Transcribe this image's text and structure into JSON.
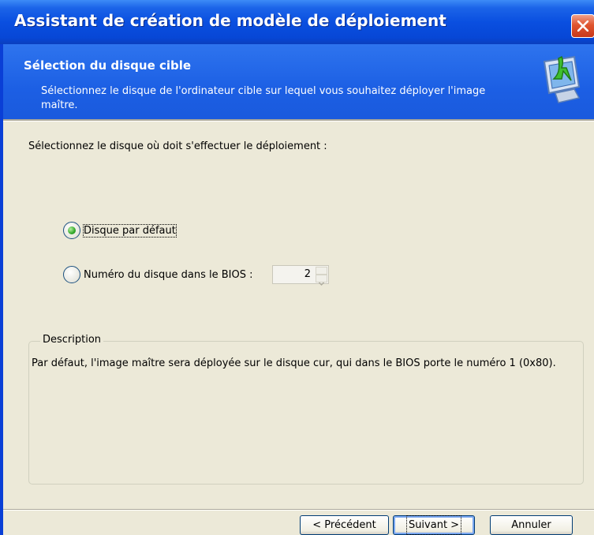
{
  "window": {
    "title": "Assistant de création de modèle de déploiement",
    "close_icon": "close-icon"
  },
  "header": {
    "title": "Sélection du disque cible",
    "description": "Sélectionnez le disque de l'ordinateur cible sur lequel vous souhaitez déployer l'image maître.",
    "icon": "monitor-install-icon"
  },
  "body": {
    "prompt": "Sélectionnez le disque où doit s'effectuer le déploiement :",
    "options": [
      {
        "label": "Disque par défaut",
        "selected": true
      },
      {
        "label": "Numéro du disque dans le BIOS :",
        "selected": false
      }
    ],
    "bios_disk_number": "2"
  },
  "description_group": {
    "title": "Description",
    "text": "Par défaut, l'image maître sera déployée sur le disque cur, qui dans le BIOS porte le numéro 1 (0x80)."
  },
  "buttons": {
    "previous": "< Précédent",
    "next": "Suivant >",
    "cancel": "Annuler"
  },
  "colors": {
    "title_bar": "#0a4fe0",
    "header_band": "#1c5fe4",
    "dialog_background": "#ece9d8",
    "radio_selected": "#31a82b"
  }
}
